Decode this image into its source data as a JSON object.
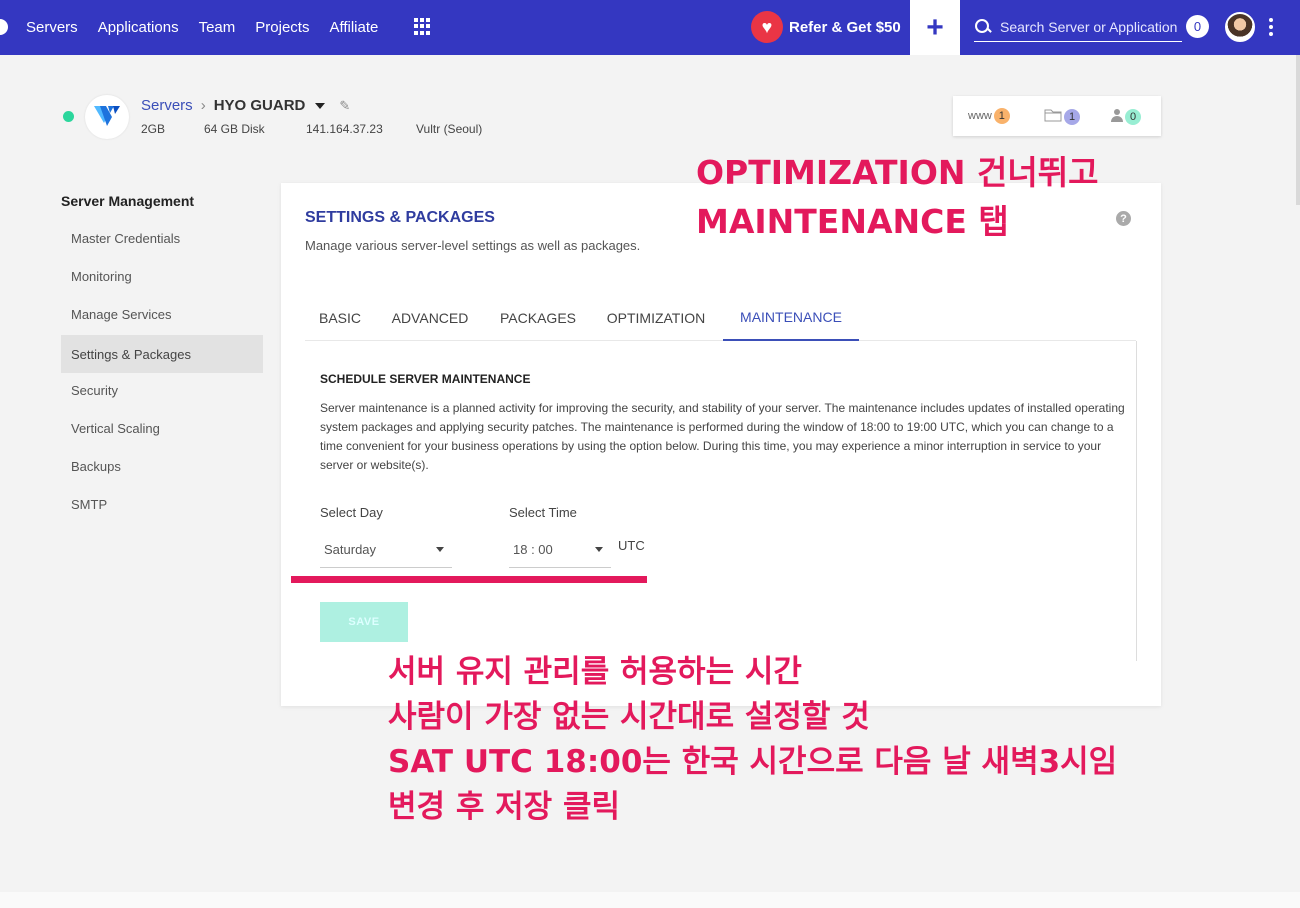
{
  "nav": {
    "items": [
      "Servers",
      "Applications",
      "Team",
      "Projects",
      "Affiliate"
    ],
    "refer_label": "Refer & Get $50",
    "add_label": "+",
    "search_placeholder": "Search Server or Application",
    "notification_count": "0"
  },
  "server": {
    "breadcrumb_parent": "Servers",
    "breadcrumb_sep": "›",
    "name": "HYO GUARD",
    "ram": "2GB",
    "disk": "64 GB Disk",
    "ip": "141.164.37.23",
    "provider": "Vultr (Seoul)"
  },
  "stats": {
    "www_label": "www",
    "www_count": "1",
    "folder_count": "1",
    "user_count": "0"
  },
  "sidebar": {
    "title": "Server Management",
    "items": [
      {
        "label": "Master Credentials",
        "active": false
      },
      {
        "label": "Monitoring",
        "active": false
      },
      {
        "label": "Manage Services",
        "active": false
      },
      {
        "label": "Settings & Packages",
        "active": true
      },
      {
        "label": "Security",
        "active": false
      },
      {
        "label": "Vertical Scaling",
        "active": false
      },
      {
        "label": "Backups",
        "active": false
      },
      {
        "label": "SMTP",
        "active": false
      }
    ]
  },
  "card": {
    "title": "SETTINGS & PACKAGES",
    "subtitle": "Manage various server-level settings as well as packages.",
    "help": "?",
    "tabs": [
      {
        "label": "BASIC",
        "active": false
      },
      {
        "label": "ADVANCED",
        "active": false
      },
      {
        "label": "PACKAGES",
        "active": false
      },
      {
        "label": "OPTIMIZATION",
        "active": false
      },
      {
        "label": "MAINTENANCE",
        "active": true
      }
    ]
  },
  "maintenance": {
    "title": "SCHEDULE SERVER MAINTENANCE",
    "description": "Server maintenance is a planned activity for improving the security, and stability of your server. The maintenance includes updates of installed operating system packages and applying security patches. The maintenance is performed during the window of 18:00 to 19:00 UTC, which you can change to a time convenient for your business operations by using the option below. During this time, you may experience a minor interruption in service to your server or website(s).",
    "day_label": "Select Day",
    "day_value": "Saturday",
    "time_label": "Select Time",
    "time_value": "18 : 00",
    "timezone": "UTC",
    "save_label": "SAVE"
  },
  "annotations": {
    "top_line1": "OPTIMIZATION 건너뛰고",
    "top_line2": "MAINTENANCE 탭",
    "bottom_line1": "서버 유지 관리를 허용하는 시간",
    "bottom_line2": "사람이 가장 없는 시간대로 설정할 것",
    "bottom_line3": "SAT UTC 18:00는 한국 시간으로 다음 날 새벽3시임",
    "bottom_line4": "변경 후 저장 클릭",
    "color": "#e3195c"
  },
  "colors": {
    "nav_bg": "#3437c1",
    "accent": "#3b4fb8",
    "status_online": "#2bd69c",
    "save_button": "#aef0e1"
  }
}
